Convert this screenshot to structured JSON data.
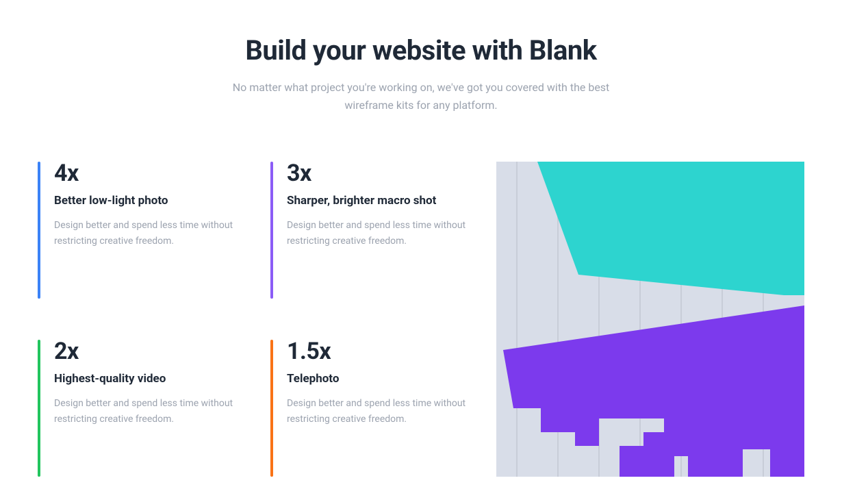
{
  "header": {
    "title": "Build your website with Blank",
    "subtitle": "No matter what project you're working on, we've got you covered with the best wireframe kits for any platform."
  },
  "features": [
    {
      "stat": "4x",
      "title": "Better low-light photo",
      "description": "Design better and spend less time without restricting creative freedom.",
      "accent_color": "#3b82f6"
    },
    {
      "stat": "3x",
      "title": "Sharper, brighter macro shot",
      "description": "Design better and spend less time without restricting creative freedom.",
      "accent_color": "#8b5cf6"
    },
    {
      "stat": "2x",
      "title": "Highest-quality video",
      "description": "Design better and spend less time without restricting creative freedom.",
      "accent_color": "#22c55e"
    },
    {
      "stat": "1.5x",
      "title": "Telephoto",
      "description": "Design better and spend less time without restricting creative freedom.",
      "accent_color": "#f97316"
    }
  ],
  "image": {
    "colors": {
      "background": "#d8dde8",
      "teal": "#2dd4cf",
      "purple": "#7c3aed"
    }
  }
}
